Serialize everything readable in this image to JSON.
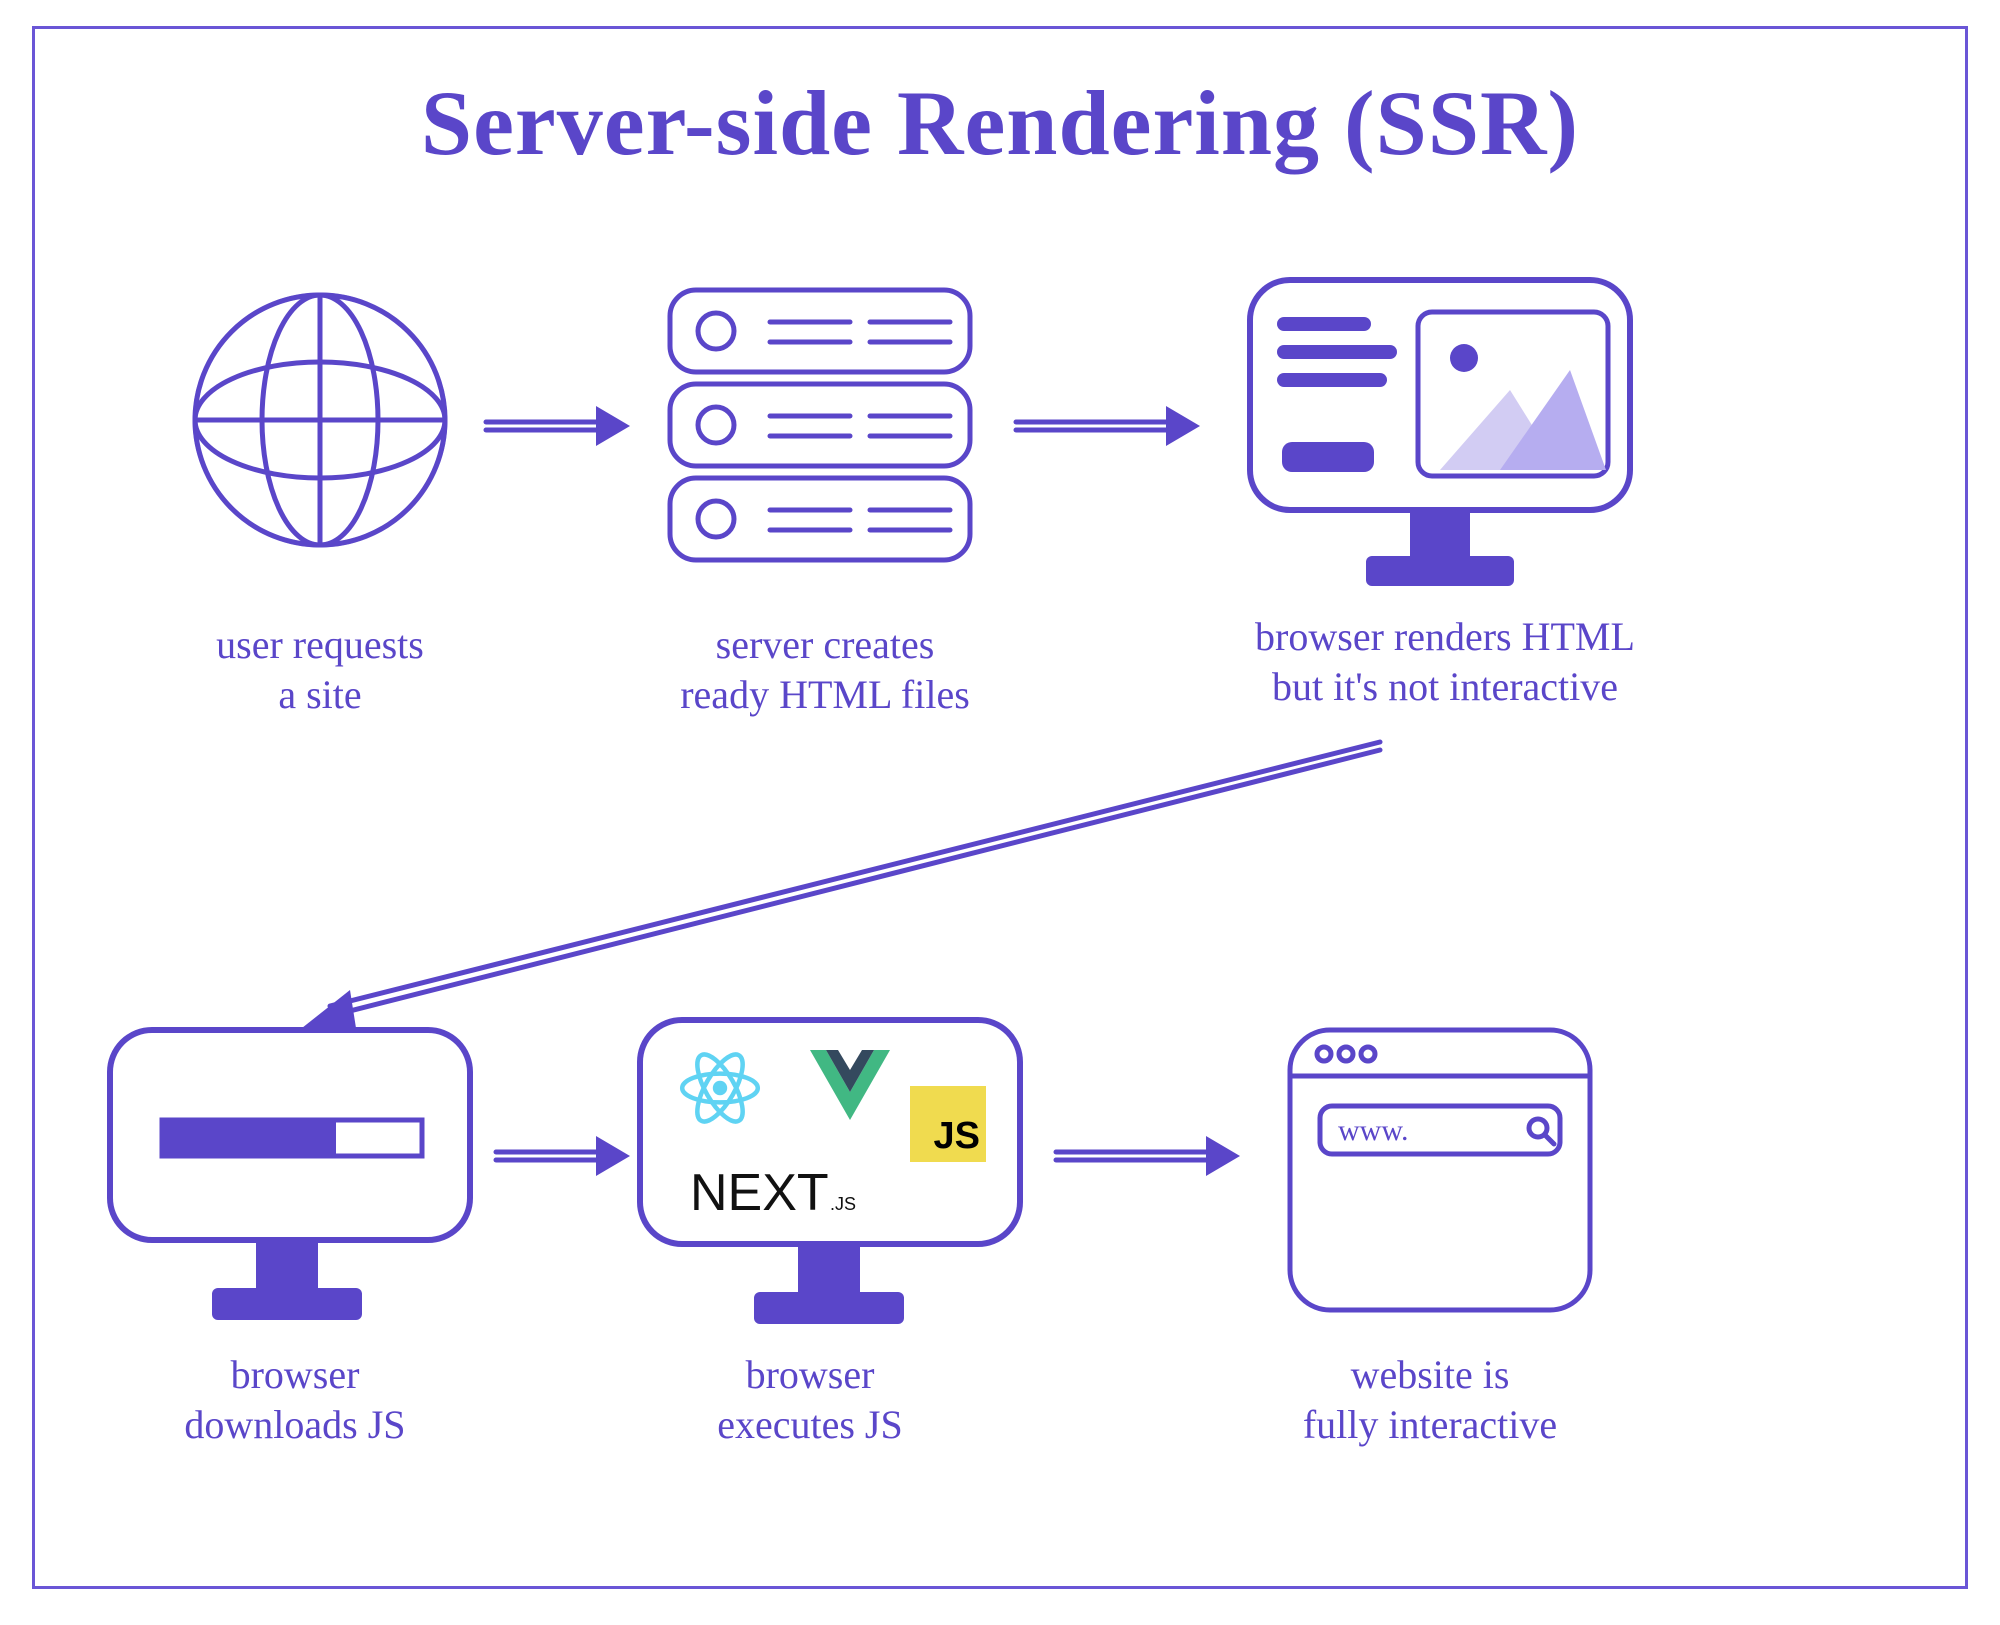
{
  "title": "Server-side Rendering (SSR)",
  "steps": [
    {
      "id": "globe",
      "caption": "user requests\na site"
    },
    {
      "id": "server",
      "caption": "server creates\nready HTML files"
    },
    {
      "id": "render",
      "caption": "browser renders HTML\nbut it's not interactive"
    },
    {
      "id": "download",
      "caption": "browser\ndownloads JS"
    },
    {
      "id": "execute",
      "caption": "browser\nexecutes JS"
    },
    {
      "id": "ready",
      "caption": "website is\nfully interactive"
    }
  ],
  "frameworks": {
    "react": "React",
    "vue": "Vue",
    "js": "JS",
    "next": "NEXT.JS"
  },
  "browser_url": "www.",
  "colors": {
    "ink": "#5a46c9",
    "ink_dark": "#4b3ab8",
    "fill": "#6a56d6",
    "pale": "#d7d2f4",
    "js_yellow": "#f0db4f",
    "react": "#5fd3f3",
    "vue_dark": "#34495e",
    "vue_green": "#41b883"
  }
}
